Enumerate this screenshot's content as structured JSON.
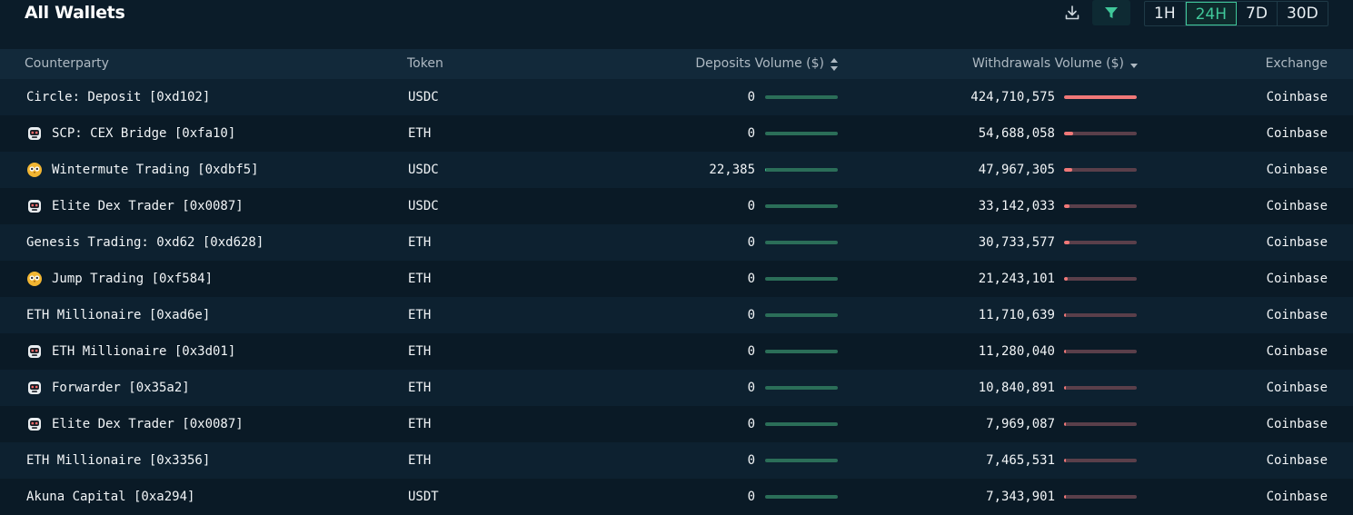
{
  "header": {
    "title": "All Wallets",
    "download_icon": "download-icon",
    "filter_icon": "filter-icon",
    "timeframes": [
      "1H",
      "24H",
      "7D",
      "30D"
    ],
    "active_timeframe": "24H"
  },
  "columns": {
    "counterparty": "Counterparty",
    "token": "Token",
    "deposits": "Deposits Volume ($)",
    "withdrawals": "Withdrawals Volume ($)",
    "exchange": "Exchange"
  },
  "colors": {
    "background": "#0b1c29",
    "accent": "#40c79a",
    "deposit_bar": "#3fbf90",
    "withdraw_bar": "#f07878"
  },
  "rows": [
    {
      "counterparty": "Circle: Deposit [0xd102]",
      "icon": "",
      "token": "USDC",
      "deposit": "0",
      "deposit_fill": 0,
      "withdraw": "424,710,575",
      "withdraw_fill": 1.0,
      "exchange": "Coinbase"
    },
    {
      "counterparty": "SCP: CEX Bridge [0xfa10]",
      "icon": "robot-icon",
      "token": "ETH",
      "deposit": "0",
      "deposit_fill": 0,
      "withdraw": "54,688,058",
      "withdraw_fill": 0.129,
      "exchange": "Coinbase"
    },
    {
      "counterparty": "Wintermute Trading [0xdbf5]",
      "icon": "owl-icon",
      "token": "USDC",
      "deposit": "22,385",
      "deposit_fill": 0.01,
      "withdraw": "47,967,305",
      "withdraw_fill": 0.113,
      "exchange": "Coinbase"
    },
    {
      "counterparty": "Elite Dex Trader [0x0087]",
      "icon": "robot-icon",
      "token": "USDC",
      "deposit": "0",
      "deposit_fill": 0,
      "withdraw": "33,142,033",
      "withdraw_fill": 0.078,
      "exchange": "Coinbase"
    },
    {
      "counterparty": "Genesis Trading: 0xd62 [0xd628]",
      "icon": "",
      "token": "ETH",
      "deposit": "0",
      "deposit_fill": 0,
      "withdraw": "30,733,577",
      "withdraw_fill": 0.072,
      "exchange": "Coinbase"
    },
    {
      "counterparty": "Jump Trading [0xf584]",
      "icon": "owl-icon",
      "token": "ETH",
      "deposit": "0",
      "deposit_fill": 0,
      "withdraw": "21,243,101",
      "withdraw_fill": 0.05,
      "exchange": "Coinbase"
    },
    {
      "counterparty": "ETH Millionaire [0xad6e]",
      "icon": "",
      "token": "ETH",
      "deposit": "0",
      "deposit_fill": 0,
      "withdraw": "11,710,639",
      "withdraw_fill": 0.028,
      "exchange": "Coinbase"
    },
    {
      "counterparty": "ETH Millionaire [0x3d01]",
      "icon": "robot-icon",
      "token": "ETH",
      "deposit": "0",
      "deposit_fill": 0,
      "withdraw": "11,280,040",
      "withdraw_fill": 0.027,
      "exchange": "Coinbase"
    },
    {
      "counterparty": "Forwarder [0x35a2]",
      "icon": "robot-icon",
      "token": "ETH",
      "deposit": "0",
      "deposit_fill": 0,
      "withdraw": "10,840,891",
      "withdraw_fill": 0.026,
      "exchange": "Coinbase"
    },
    {
      "counterparty": "Elite Dex Trader [0x0087]",
      "icon": "robot-icon",
      "token": "ETH",
      "deposit": "0",
      "deposit_fill": 0,
      "withdraw": "7,969,087",
      "withdraw_fill": 0.019,
      "exchange": "Coinbase"
    },
    {
      "counterparty": "ETH Millionaire [0x3356]",
      "icon": "",
      "token": "ETH",
      "deposit": "0",
      "deposit_fill": 0,
      "withdraw": "7,465,531",
      "withdraw_fill": 0.018,
      "exchange": "Coinbase"
    },
    {
      "counterparty": "Akuna Capital [0xa294]",
      "icon": "",
      "token": "USDT",
      "deposit": "0",
      "deposit_fill": 0,
      "withdraw": "7,343,901",
      "withdraw_fill": 0.017,
      "exchange": "Coinbase"
    }
  ]
}
